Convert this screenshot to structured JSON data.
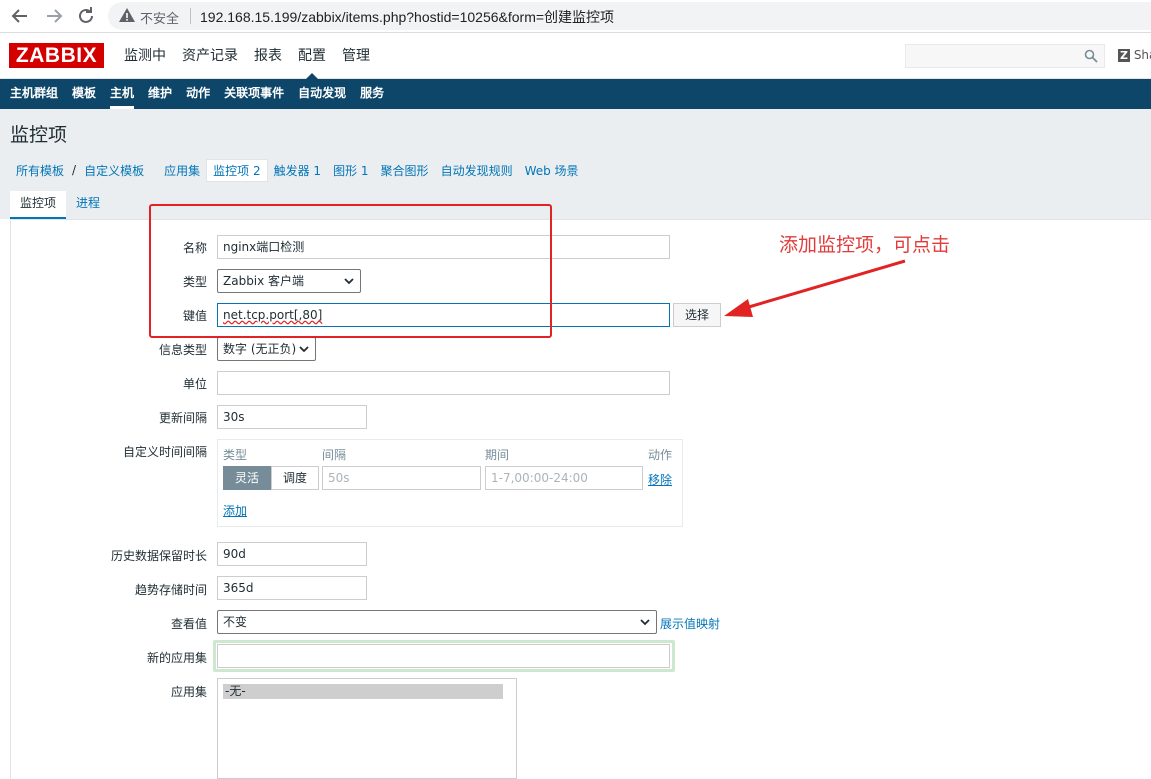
{
  "browser": {
    "back_icon": "arrow-left-icon",
    "forward_icon": "arrow-right-icon",
    "reload_icon": "reload-icon",
    "security_label": "不安全",
    "url": "192.168.15.199/zabbix/items.php?hostid=10256&form=创建监控项"
  },
  "header": {
    "logo": "ZABBIX",
    "menu": [
      "监测中",
      "资产记录",
      "报表",
      "配置",
      "管理"
    ],
    "active_menu": "配置",
    "search_value": "",
    "share_badge": "Z",
    "share_label": "Sha"
  },
  "submenu": [
    "主机群组",
    "模板",
    "主机",
    "维护",
    "动作",
    "关联项事件",
    "自动发现",
    "服务"
  ],
  "page": {
    "title": "监控项",
    "breadcrumbs": {
      "all_templates": "所有模板",
      "template": "自定义模板",
      "applications": "应用集",
      "items": "监控项",
      "items_count": "2",
      "triggers": "触发器",
      "triggers_count": "1",
      "graphs": "图形",
      "graphs_count": "1",
      "screens": "聚合图形",
      "discovery": "自动发现规则",
      "web": "Web 场景"
    },
    "tabs": [
      "监控项",
      "进程"
    ]
  },
  "form": {
    "name_label": "名称",
    "name_value": "nginx端口检测",
    "type_label": "类型",
    "type_value": "Zabbix 客户端",
    "key_label": "键值",
    "key_value": "net.tcp.port[,80]",
    "select_button": "选择",
    "info_type_label": "信息类型",
    "info_type_value": "数字 (无正负)",
    "units_label": "单位",
    "units_value": "",
    "update_interval_label": "更新间隔",
    "update_interval_value": "30s",
    "custom_intervals_label": "自定义时间间隔",
    "custom_intervals": {
      "col_type": "类型",
      "col_interval": "间隔",
      "col_period": "期间",
      "col_action": "动作",
      "flexible": "灵活",
      "scheduling": "调度",
      "interval_placeholder": "50s",
      "period_placeholder": "1-7,00:00-24:00",
      "remove": "移除",
      "add": "添加"
    },
    "history_label": "历史数据保留时长",
    "history_value": "90d",
    "trends_label": "趋势存储时间",
    "trends_value": "365d",
    "valuemap_label": "查看值",
    "valuemap_value": "不变",
    "valuemap_link": "展示值映射",
    "new_app_label": "新的应用集",
    "new_app_value": "",
    "apps_label": "应用集",
    "apps_option": "-无-"
  },
  "annotation": {
    "text": "添加监控项，可点击",
    "color": "#e23b3b"
  },
  "colors": {
    "brand_red": "#d40000",
    "nav_blue": "#0e4669",
    "link_blue": "#0275b8"
  }
}
